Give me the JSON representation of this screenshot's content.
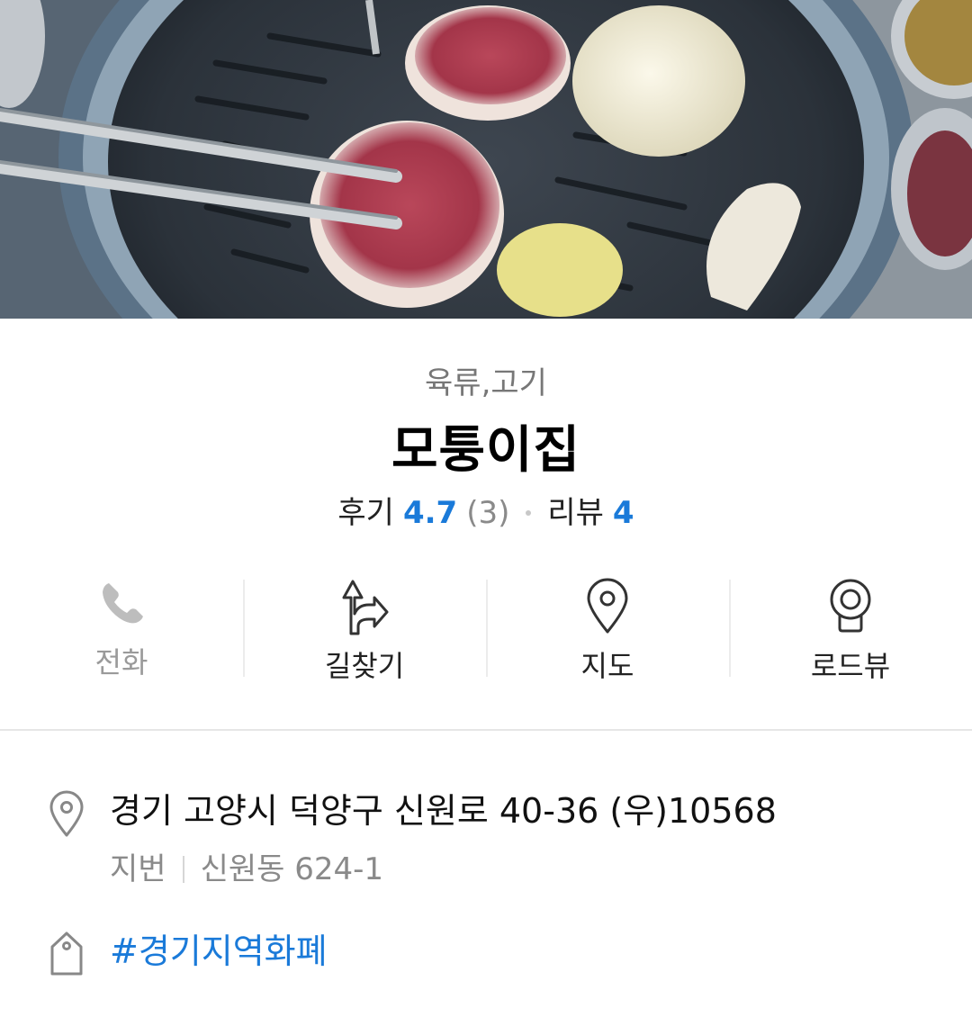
{
  "place": {
    "category": "육류,고기",
    "name": "모퉁이집"
  },
  "ratings": {
    "review_label": "후기",
    "review_score": "4.7",
    "review_count": "(3)",
    "blog_label": "리뷰",
    "blog_count": "4"
  },
  "actions": [
    {
      "label": "전화",
      "icon": "phone-icon",
      "enabled": false
    },
    {
      "label": "길찾기",
      "icon": "directions-icon",
      "enabled": true
    },
    {
      "label": "지도",
      "icon": "map-pin-icon",
      "enabled": true
    },
    {
      "label": "로드뷰",
      "icon": "roadview-camera-icon",
      "enabled": true
    }
  ],
  "details": {
    "address": "경기 고양시 덕양구 신원로 40-36 (우)10568",
    "jibun_label": "지번",
    "jibun_value": "신원동 624-1",
    "tag": "#경기지역화폐",
    "address_icon": "location-pin-icon",
    "tag_icon": "tag-icon"
  },
  "colors": {
    "accent": "#1a7ad9",
    "muted": "#8a8a8a"
  }
}
